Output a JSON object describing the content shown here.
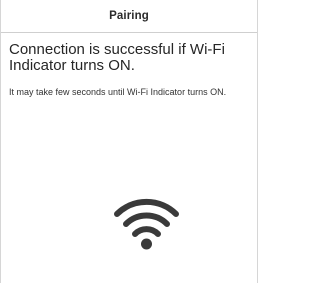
{
  "header": {
    "title": "Pairing"
  },
  "content": {
    "headline": "Connection is successful if Wi-Fi Indicator turns ON.",
    "description": "It may take few seconds until Wi-Fi Indicator turns ON.",
    "indicator_icon": "wifi-icon"
  },
  "colors": {
    "text": "#262626",
    "icon": "#3a3a3a",
    "divider": "#cfcfcf"
  }
}
